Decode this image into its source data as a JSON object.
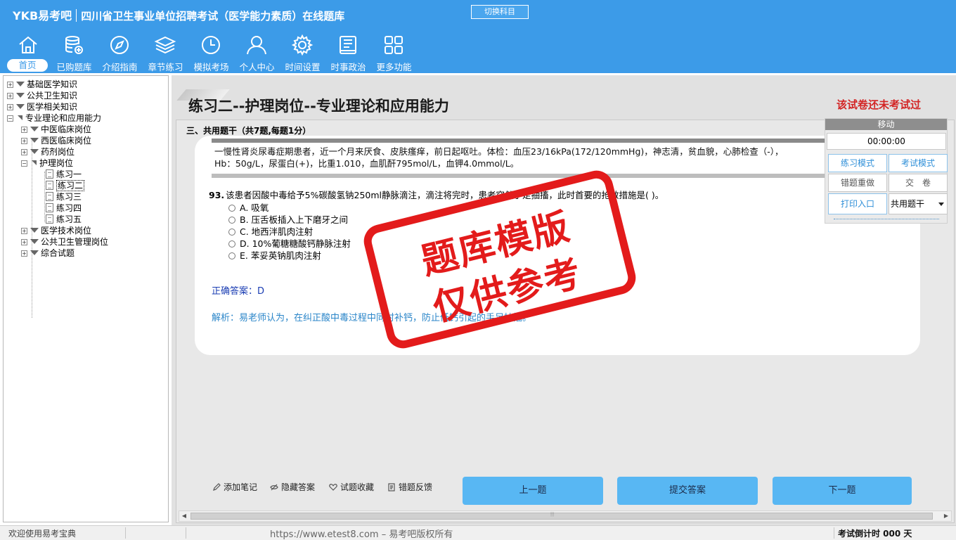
{
  "header": {
    "brand": "YKB易考吧",
    "title": "四川省卫生事业单位招聘考试（医学能力素质）在线题库",
    "switch_label": "切换科目"
  },
  "nav": [
    {
      "label": "首页",
      "icon": "home-icon"
    },
    {
      "label": "已购题库",
      "icon": "database-icon"
    },
    {
      "label": "介绍指南",
      "icon": "compass-icon"
    },
    {
      "label": "章节练习",
      "icon": "layers-icon"
    },
    {
      "label": "模拟考场",
      "icon": "clock-icon"
    },
    {
      "label": "个人中心",
      "icon": "user-icon"
    },
    {
      "label": "时间设置",
      "icon": "gear-icon"
    },
    {
      "label": "时事政治",
      "icon": "news-icon"
    },
    {
      "label": "更多功能",
      "icon": "grid-icon"
    }
  ],
  "tree": {
    "n1": "基础医学知识",
    "n2": "公共卫生知识",
    "n3": "医学相关知识",
    "n4": "专业理论和应用能力",
    "n4_1": "中医临床岗位",
    "n4_2": "西医临床岗位",
    "n4_3": "药剂岗位",
    "n4_4": "护理岗位",
    "e1": "练习一",
    "e2": "练习二",
    "e3": "练习三",
    "e4": "练习四",
    "e5": "练习五",
    "n4_5": "医学技术岗位",
    "n4_6": "公共卫生管理岗位",
    "n4_7": "综合试题"
  },
  "main": {
    "paper_title": "练习二--护理岗位--专业理论和应用能力",
    "not_taken": "该试卷还未考试过",
    "section": "三、共用题干（共7题,每题1分）",
    "stem_line1": "一慢性肾炎尿毒症期患者，近一个月来厌食、皮肤瘙痒，前日起呕吐。体检：血压23/16kPa(172/120mmHg)，神志清，贫血貌，心肺检查（-），",
    "stem_line2": "Hb：50g/L，尿蛋白(+)，比重1.010，血肌酐795mol/L，血钾4.0mmol/L。",
    "q_num": "93.",
    "q_text": "该患者因酸中毒给予5%碳酸氢钠250ml静脉滴注，滴注将完时，患者突然手足抽搐，此时首要的抢救措施是( )。",
    "options": [
      "A. 吸氧",
      "B. 压舌板插入上下磨牙之间",
      "C. 地西泮肌肉注射",
      "D. 10%葡糖糖酸钙静脉注射",
      "E. 苯妥英钠肌肉注射"
    ],
    "answer": "正确答案：D",
    "analysis": "解析：易老师认为，在纠正酸中毒过程中同时补钙，防止低钙引起的手足抽搐。",
    "stamp_line1": "题库模版",
    "stamp_line2": "仅供参考"
  },
  "tools": {
    "note": "添加笔记",
    "hide": "隐藏答案",
    "fav": "试题收藏",
    "report": "错题反馈",
    "prev": "上一题",
    "submit": "提交答案",
    "next": "下一题"
  },
  "ctrl": {
    "move": "移动",
    "timer": "00:00:00",
    "practice": "练习模式",
    "exam": "考试模式",
    "redo": "错题重做",
    "handin": "交　卷",
    "print": "打印入口",
    "select": "共用题干"
  },
  "status": {
    "welcome": "欢迎使用易考宝典",
    "copyright": "https://www.etest8.com – 易考吧版权所有",
    "countdown": "考试倒计时 000 天"
  },
  "colors": {
    "header_bg": "#3c9be8",
    "button_blue": "#58b7f3",
    "warning_red": "#d32424",
    "stamp_red": "#e31b1b",
    "answer_blue": "#1a3db3"
  }
}
